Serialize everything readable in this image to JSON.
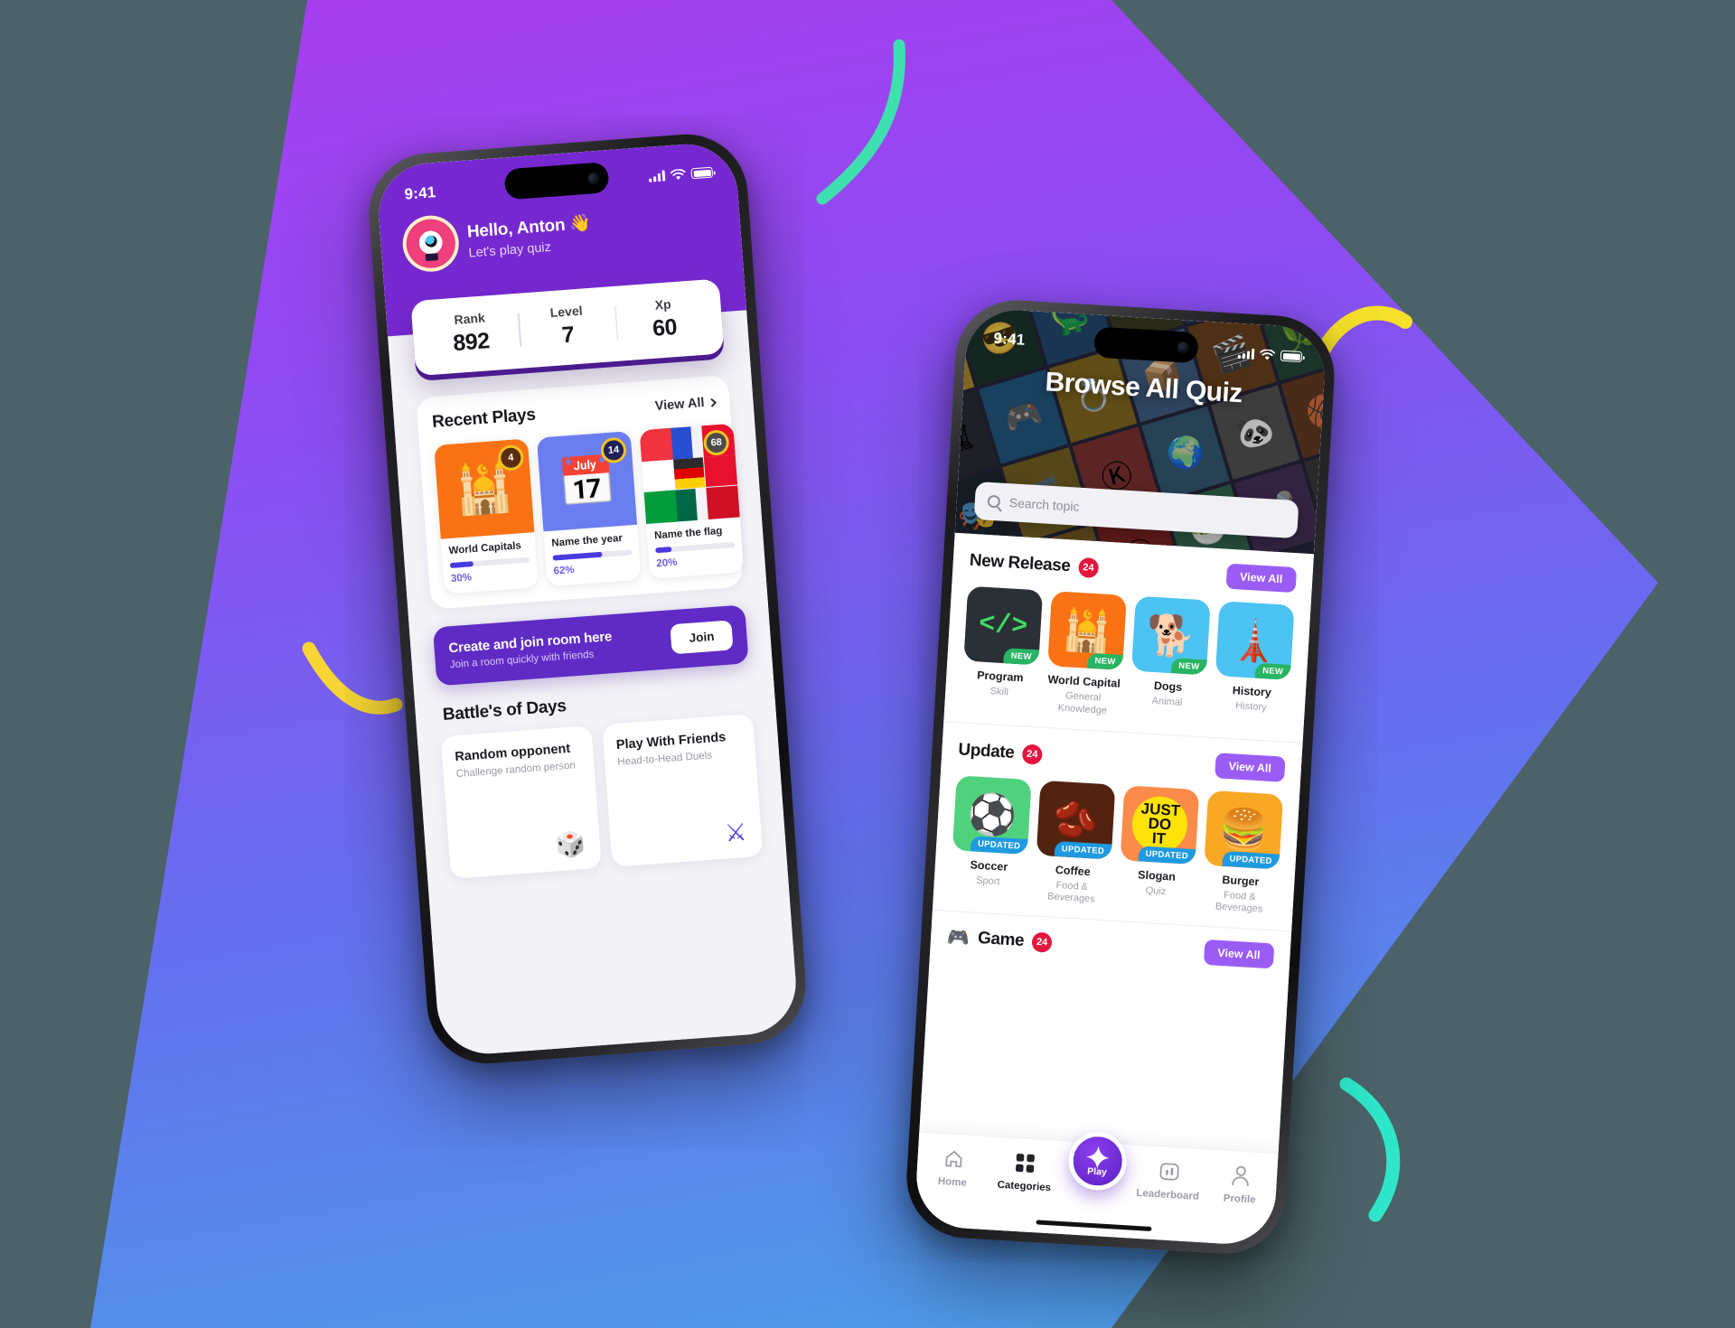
{
  "background": {
    "base_color": "#4a6268",
    "gradient_from": "#a43bee",
    "gradient_to": "#4f9fe8"
  },
  "phone1": {
    "status_bar": {
      "time": "9:41",
      "signal_icon": "signal-bars-icon",
      "wifi_icon": "wifi-icon",
      "battery_icon": "battery-icon"
    },
    "header": {
      "avatar_icon": "monster-avatar",
      "greeting": "Hello, Anton 👋",
      "subtitle": "Let's play quiz"
    },
    "stats": [
      {
        "label": "Rank",
        "value": "892"
      },
      {
        "label": "Level",
        "value": "7"
      },
      {
        "label": "Xp",
        "value": "60"
      }
    ],
    "recent_plays": {
      "title": "Recent Plays",
      "view_all": "View All",
      "items": [
        {
          "name": "World Capitals",
          "percent": "30%",
          "progress": 30,
          "badge": "4",
          "emoji": "🕌",
          "bg": "#f97316",
          "badge_bg": "#5a2d10"
        },
        {
          "name": "Name the year",
          "percent": "62%",
          "progress": 62,
          "badge": "14",
          "emoji": "📅",
          "bg": "#6b7ef0",
          "badge_bg": "#1f2158"
        },
        {
          "name": "Name the flag",
          "percent": "20%",
          "progress": 20,
          "badge": "68",
          "emoji": "🏳️",
          "bg": "#f4f4f6",
          "badge_bg": "#4a4a4a"
        }
      ]
    },
    "room_banner": {
      "title": "Create and join room here",
      "subtitle": "Join a room quickly with friends",
      "button": "Join"
    },
    "battles": {
      "title": "Battle's of Days",
      "items": [
        {
          "name": "Random opponent",
          "subtitle": "Challenge random person",
          "icon": "🎲"
        },
        {
          "name": "Play With Friends",
          "subtitle": "Head-to-Head Duels",
          "icon": "⚔"
        }
      ]
    }
  },
  "phone2": {
    "status_bar": {
      "time": "9:41",
      "signal_icon": "signal-bars-icon",
      "wifi_icon": "wifi-icon",
      "battery_icon": "battery-icon"
    },
    "hero": {
      "title": "Browse All Quiz"
    },
    "search": {
      "placeholder": "Search topic",
      "icon": "search-icon"
    },
    "sections": [
      {
        "title": "New Release",
        "count": "24",
        "view_all": "View All",
        "items": [
          {
            "name": "Program",
            "category": "Skill",
            "flag": "NEW",
            "flag_type": "new",
            "emoji": "🖥",
            "bg": "#2b2f36"
          },
          {
            "name": "World Capital",
            "category": "General Knowledge",
            "flag": "NEW",
            "flag_type": "new",
            "emoji": "🕌",
            "bg": "#f97316"
          },
          {
            "name": "Dogs",
            "category": "Animal",
            "flag": "NEW",
            "flag_type": "new",
            "emoji": "🐕",
            "bg": "#4cc3f2"
          },
          {
            "name": "History",
            "category": "History",
            "flag": "NEW",
            "flag_type": "new",
            "emoji": "🗼",
            "bg": "#4cc3f2"
          }
        ]
      },
      {
        "title": "Update",
        "count": "24",
        "view_all": "View All",
        "items": [
          {
            "name": "Soccer",
            "category": "Sport",
            "flag": "UPDATED",
            "flag_type": "upd",
            "emoji": "⚽",
            "bg": "#4fd17d"
          },
          {
            "name": "Coffee",
            "category": "Food & Beverages",
            "flag": "UPDATED",
            "flag_type": "upd",
            "emoji": "🫘",
            "bg": "#52230f"
          },
          {
            "name": "Slogan",
            "category": "Quiz",
            "flag": "UPDATED",
            "flag_type": "upd",
            "emoji": "🎯",
            "bg": "#fb8b4a"
          },
          {
            "name": "Burger",
            "category": "Food & Beverages",
            "flag": "UPDATED",
            "flag_type": "upd",
            "emoji": "🍔",
            "bg": "#f9a825"
          }
        ]
      }
    ],
    "game_section": {
      "title": "Game",
      "count": "24",
      "view_all": "View All",
      "emoji": "🎮"
    },
    "tabbar": [
      {
        "label": "Home",
        "icon": "home-icon",
        "active": false
      },
      {
        "label": "Categories",
        "icon": "grid-icon",
        "active": true
      },
      {
        "label": "Play",
        "icon": "sparkle-icon",
        "active": false
      },
      {
        "label": "Leaderboard",
        "icon": "bar-chart-icon",
        "active": false
      },
      {
        "label": "Profile",
        "icon": "person-icon",
        "active": false
      }
    ]
  }
}
